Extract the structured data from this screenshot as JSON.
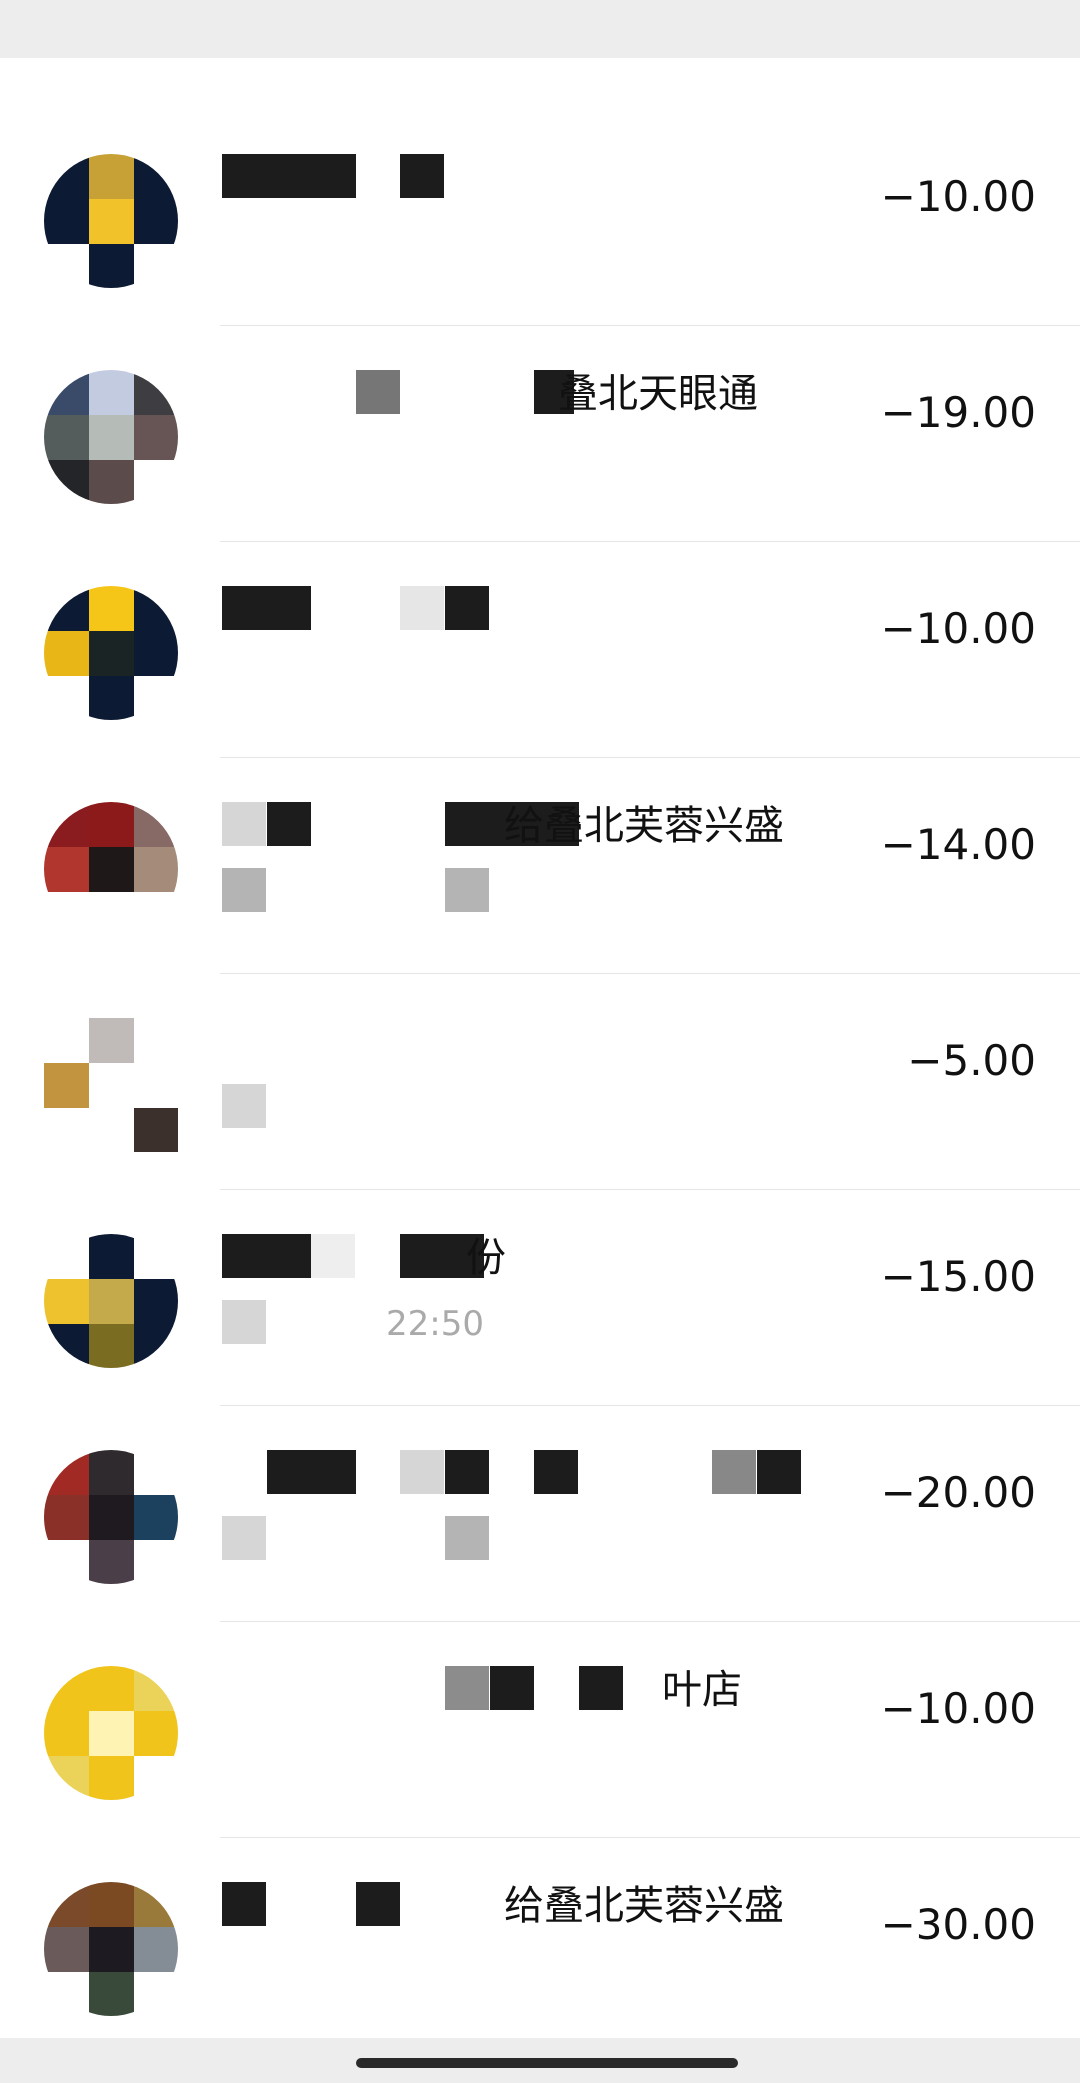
{
  "transactions": [
    {
      "title": "",
      "subtitle": "",
      "amount": "−10.00"
    },
    {
      "title": "叠北天眼通",
      "subtitle": "",
      "amount": "−19.00"
    },
    {
      "title": "",
      "subtitle": "",
      "amount": "−10.00"
    },
    {
      "title": "给叠北芙蓉兴盛",
      "subtitle": "",
      "amount": "−14.00"
    },
    {
      "title": "",
      "subtitle": "",
      "amount": "−5.00"
    },
    {
      "title": "份",
      "subtitle": "22:50",
      "amount": "−15.00"
    },
    {
      "title": "",
      "subtitle": "",
      "amount": "−20.00"
    },
    {
      "title": "叶店",
      "subtitle": "",
      "amount": "−10.00"
    },
    {
      "title": "给叠北芙蓉兴盛",
      "subtitle": "",
      "amount": "−30.00"
    }
  ],
  "avatar_colors": [
    [
      "#0c1a33",
      "#c7a136",
      "#0c1a33",
      "#0c1a33",
      "#f1c22a",
      "#0c1a33",
      "#ffffff",
      "#0c1a33",
      "#ffffff"
    ],
    [
      "#3a4b6a",
      "#c3cbe0",
      "#3d3d42",
      "#555c5c",
      "#b5bcb8",
      "#675555",
      "#242528",
      "#5b4b4b",
      "#ffffff"
    ],
    [
      "#0c1a33",
      "#f5c518",
      "#0c1a33",
      "#e8b617",
      "#1a2424",
      "#0c1a33",
      "#ffffff",
      "#0c1a33",
      "#ffffff"
    ],
    [
      "#8a1c20",
      "#8c1a1a",
      "#876965",
      "#b1362e",
      "#1e1818",
      "#a48b7a",
      "#ffffff",
      "#ffffff",
      "#ffffff"
    ],
    [
      "#ffffff",
      "#c0bbb8",
      "#ffffff",
      "#c39440",
      "#ffffff",
      "#ffffff",
      "#ffffff",
      "#ffffff",
      "#3b302c"
    ],
    [
      "#ffffff",
      "#0c1a33",
      "#ffffff",
      "#eec22f",
      "#c5aa4c",
      "#0c1a33",
      "#0c1a33",
      "#7a6c20",
      "#0c1a33"
    ],
    [
      "#a22a25",
      "#2e2a2e",
      "#ffffff",
      "#8a3028",
      "#1e1a20",
      "#1c415e",
      "#ffffff",
      "#4a3e48",
      "#ffffff"
    ],
    [
      "#f0c41a",
      "#f0c41a",
      "#ebd35a",
      "#f0c41a",
      "#fff3b3",
      "#f0c41a",
      "#ebd35a",
      "#f0c41a",
      "#ffffff"
    ],
    [
      "#7a4a2a",
      "#7c4a22",
      "#9a7a3a",
      "#6a5a5a",
      "#1e1a22",
      "#848c96",
      "#ffffff",
      "#3a4a3a",
      "#ffffff"
    ]
  ],
  "mosaic_color_dark": "#1c1c1c",
  "mosaic_color_light": "#d6d6d6",
  "mosaic_color_mid": "#b4b4b4"
}
